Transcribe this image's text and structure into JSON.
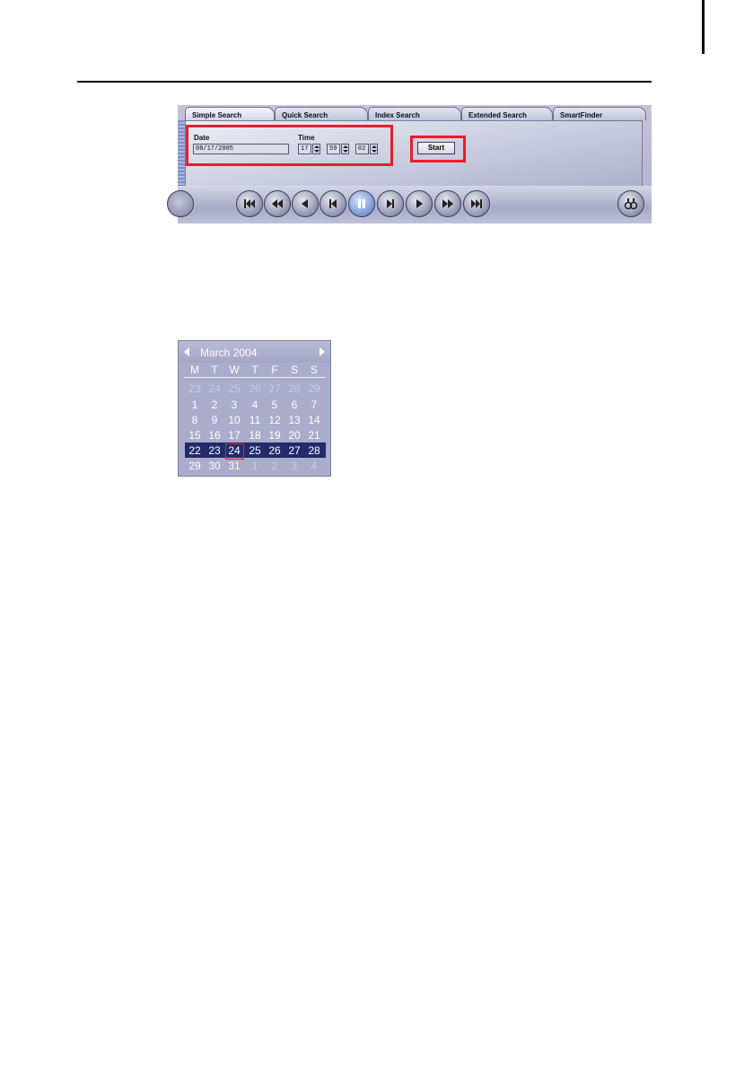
{
  "tabs": [
    {
      "label": "Simple Search",
      "active": true
    },
    {
      "label": "Quick Search",
      "active": false
    },
    {
      "label": "Index Search",
      "active": false
    },
    {
      "label": "Extended Search",
      "active": false
    },
    {
      "label": "SmartFinder",
      "active": false
    }
  ],
  "simple_search": {
    "date_label": "Date",
    "date_value": "08/17/2005",
    "time_label": "Time",
    "hour": "17",
    "minute": "59",
    "second": "02",
    "start_label": "Start"
  },
  "playback_controls": [
    "skip-to-start-icon",
    "fast-rewind-icon",
    "play-reverse-icon",
    "step-back-icon",
    "pause-icon",
    "step-forward-icon",
    "play-icon",
    "fast-forward-icon",
    "skip-to-end-icon"
  ],
  "calendar": {
    "title": "March 2004",
    "weekdays": [
      "M",
      "T",
      "W",
      "T",
      "F",
      "S",
      "S"
    ],
    "weeks": [
      [
        "23",
        "24",
        "25",
        "26",
        "27",
        "28",
        "29"
      ],
      [
        "1",
        "2",
        "3",
        "4",
        "5",
        "6",
        "7"
      ],
      [
        "8",
        "9",
        "10",
        "11",
        "12",
        "13",
        "14"
      ],
      [
        "15",
        "16",
        "17",
        "18",
        "19",
        "20",
        "21"
      ],
      [
        "22",
        "23",
        "24",
        "25",
        "26",
        "27",
        "28"
      ],
      [
        "29",
        "30",
        "31",
        "1",
        "2",
        "3",
        "4"
      ]
    ],
    "selected_day": "24",
    "colors": {
      "selected_week_bg": "#232b6b",
      "today_border": "#e3202a"
    }
  },
  "highlight_color": "#e3202a"
}
